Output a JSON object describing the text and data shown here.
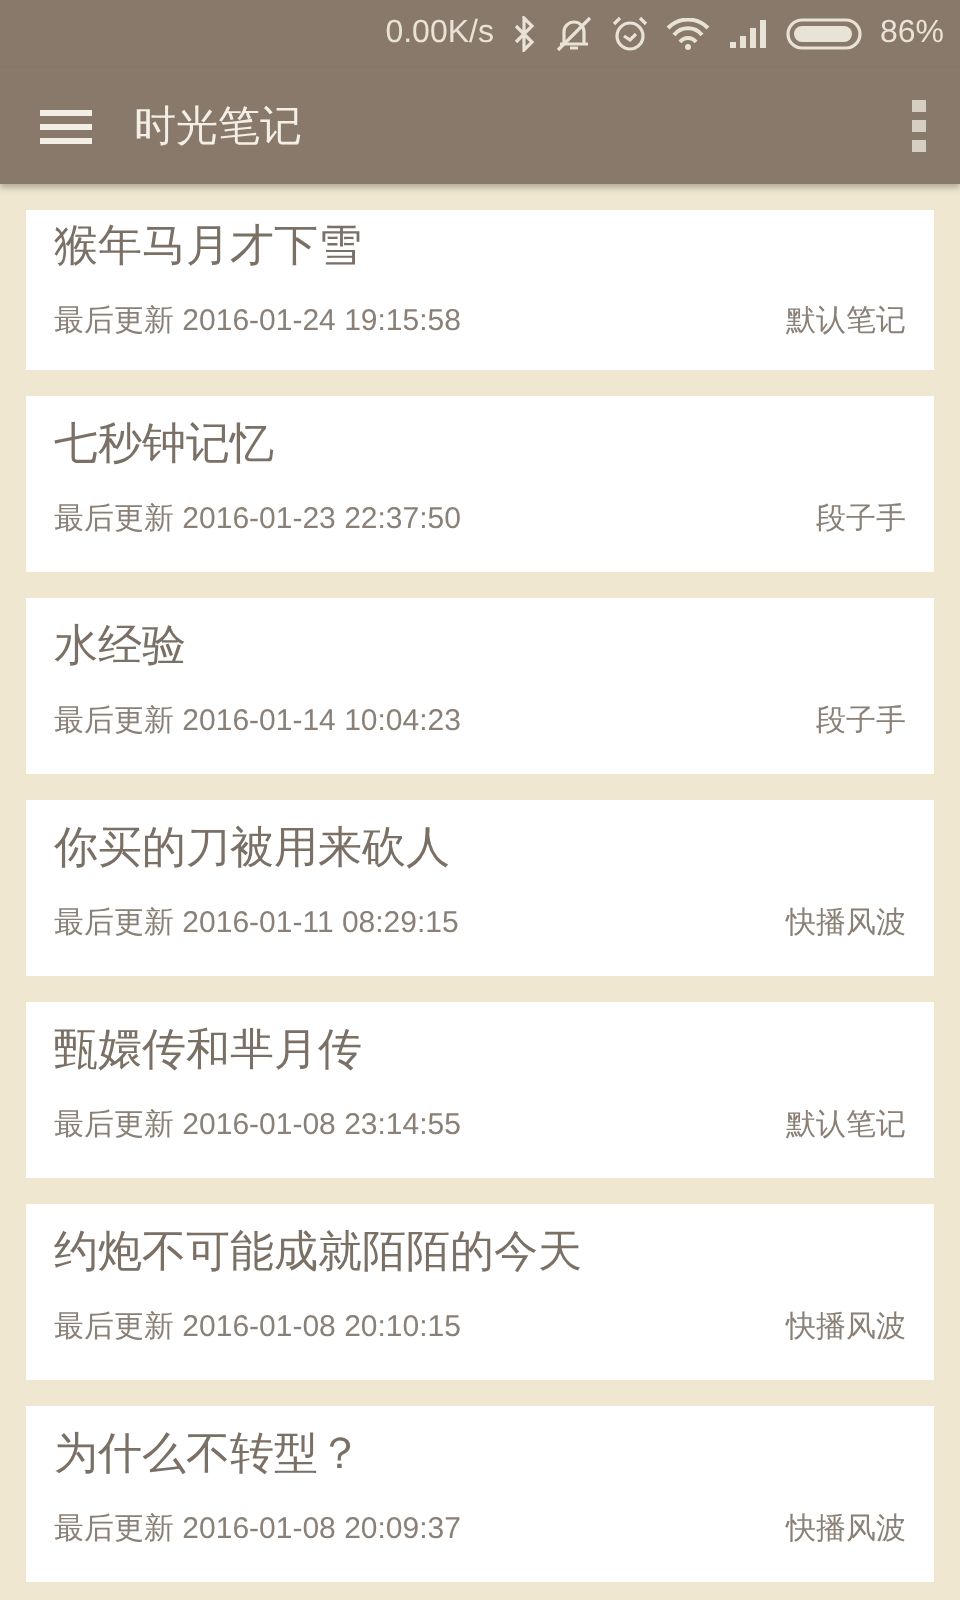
{
  "status_bar": {
    "speed": "0.00K/s",
    "battery": "86%"
  },
  "app_bar": {
    "title": "时光笔记"
  },
  "notes": [
    {
      "title": "猴年马月才下雪",
      "updated": "最后更新 2016-01-24 19:15:58",
      "notebook": "默认笔记"
    },
    {
      "title": "七秒钟记忆",
      "updated": "最后更新 2016-01-23 22:37:50",
      "notebook": "段子手"
    },
    {
      "title": "水经验",
      "updated": "最后更新 2016-01-14 10:04:23",
      "notebook": "段子手"
    },
    {
      "title": "你买的刀被用来砍人",
      "updated": "最后更新 2016-01-11 08:29:15",
      "notebook": "快播风波"
    },
    {
      "title": "甄嬛传和芈月传",
      "updated": "最后更新 2016-01-08 23:14:55",
      "notebook": "默认笔记"
    },
    {
      "title": "约炮不可能成就陌陌的今天",
      "updated": "最后更新 2016-01-08 20:10:15",
      "notebook": "快播风波"
    },
    {
      "title": "为什么不转型？",
      "updated": "最后更新 2016-01-08 20:09:37",
      "notebook": "快播风波"
    }
  ]
}
